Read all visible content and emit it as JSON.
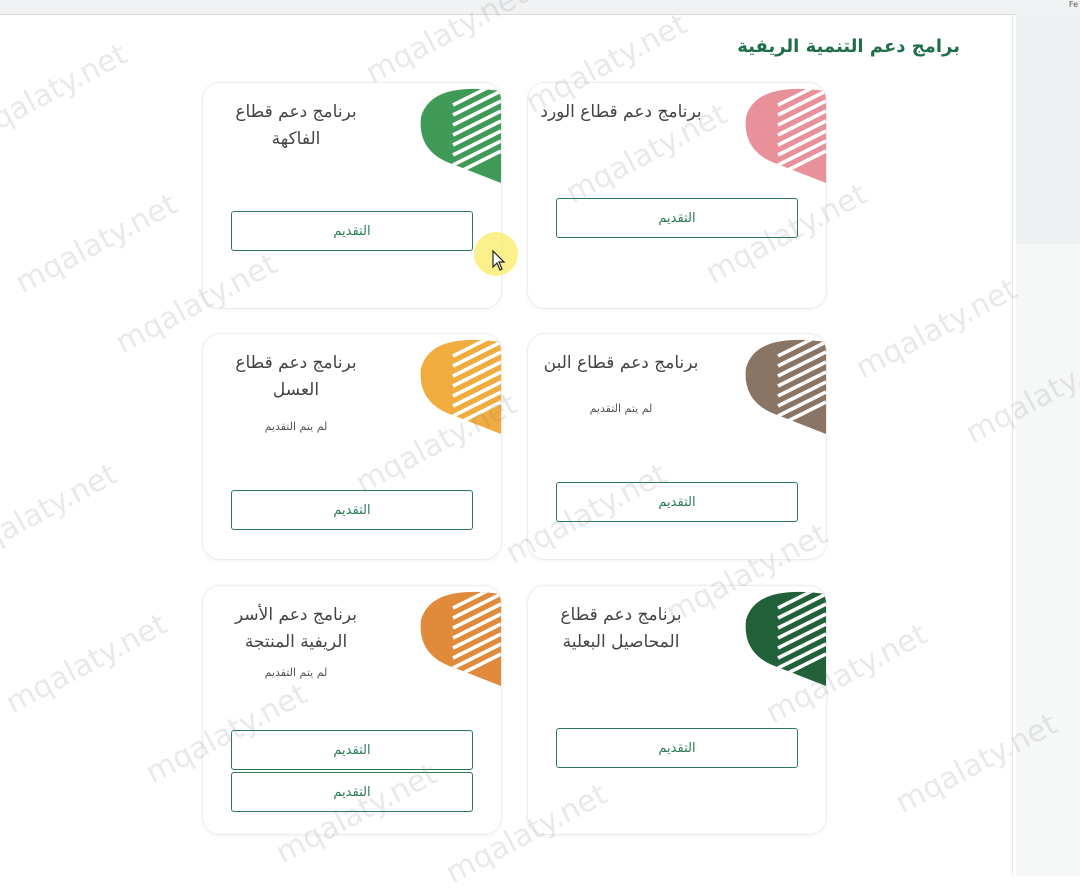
{
  "window": {
    "corner_text": "Fe"
  },
  "page": {
    "title": "برامج دعم التنمية الريفية"
  },
  "cards": [
    {
      "title": "برنامج دعم قطاع الورد",
      "status": "",
      "buttons": [
        "التقديم"
      ],
      "leaf_color": "#e8919a"
    },
    {
      "title": "برنامج دعم قطاع الفاكهة",
      "status": "",
      "buttons": [
        "التقديم"
      ],
      "leaf_color": "#3f9a57"
    },
    {
      "title": "برنامج دعم قطاع البن",
      "status": "لم يتم التقديم",
      "buttons": [
        "التقديم"
      ],
      "leaf_color": "#8a7463"
    },
    {
      "title": "برنامج دعم قطاع العسل",
      "status": "لم يتم التقديم",
      "buttons": [
        "التقديم"
      ],
      "leaf_color": "#f1ac40"
    },
    {
      "title": "برنامج دعم قطاع المحاصيل البعلية",
      "status": "",
      "buttons": [
        "التقديم"
      ],
      "leaf_color": "#22603a"
    },
    {
      "title": "برنامج دعم الأسر الريفية المنتجة",
      "status": "لم يتم التقديم",
      "buttons": [
        "التقديم",
        "التقديم"
      ],
      "leaf_color": "#e08a3c"
    }
  ],
  "watermark": "mqalaty.net"
}
